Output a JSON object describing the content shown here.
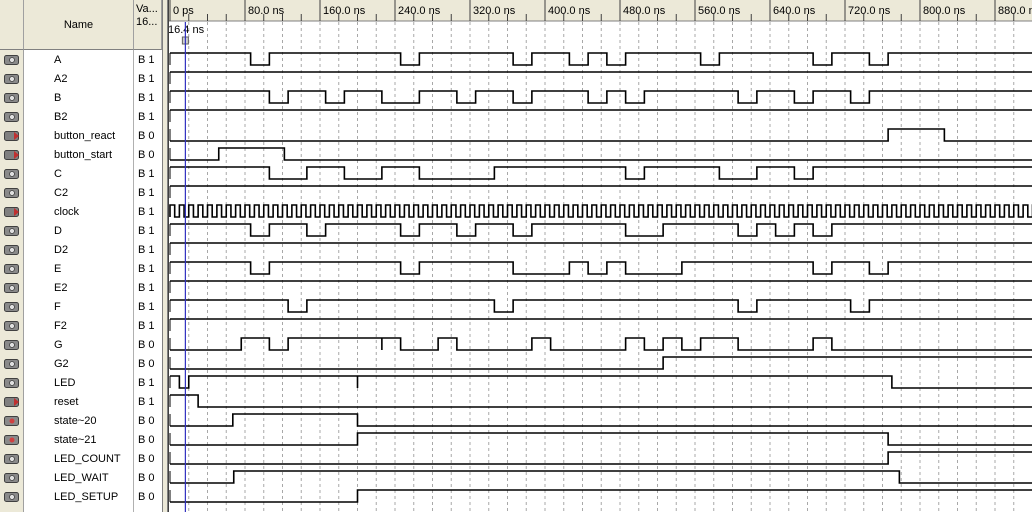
{
  "header": {
    "name_label": "Name",
    "value_label_1": "Va...",
    "value_label_2": "16..."
  },
  "time_bar": {
    "tick_labels": [
      "0 ps",
      "80.0 ns",
      "160.0 ns",
      "240.0 ns",
      "320.0 ns",
      "400.0 ns",
      "480.0 ns",
      "560.0 ns",
      "640.0 ns",
      "720.0 ns",
      "800.0 ns",
      "880.0 ns"
    ],
    "cursor_label": "16.4 ns"
  },
  "signals": [
    {
      "name": "A",
      "value": "B 1",
      "type": "output"
    },
    {
      "name": "A2",
      "value": "B 1",
      "type": "output"
    },
    {
      "name": "B",
      "value": "B 1",
      "type": "output"
    },
    {
      "name": "B2",
      "value": "B 1",
      "type": "output"
    },
    {
      "name": "button_react",
      "value": "B 0",
      "type": "input"
    },
    {
      "name": "button_start",
      "value": "B 0",
      "type": "input"
    },
    {
      "name": "C",
      "value": "B 1",
      "type": "output"
    },
    {
      "name": "C2",
      "value": "B 1",
      "type": "output"
    },
    {
      "name": "clock",
      "value": "B 1",
      "type": "input"
    },
    {
      "name": "D",
      "value": "B 1",
      "type": "output"
    },
    {
      "name": "D2",
      "value": "B 1",
      "type": "output"
    },
    {
      "name": "E",
      "value": "B 1",
      "type": "output"
    },
    {
      "name": "E2",
      "value": "B 1",
      "type": "output"
    },
    {
      "name": "F",
      "value": "B 1",
      "type": "output"
    },
    {
      "name": "F2",
      "value": "B 1",
      "type": "output"
    },
    {
      "name": "G",
      "value": "B 0",
      "type": "output"
    },
    {
      "name": "G2",
      "value": "B 0",
      "type": "output"
    },
    {
      "name": "LED",
      "value": "B 1",
      "type": "output"
    },
    {
      "name": "reset",
      "value": "B 1",
      "type": "input"
    },
    {
      "name": "state~20",
      "value": "B 0",
      "type": "buried"
    },
    {
      "name": "state~21",
      "value": "B 0",
      "type": "buried"
    },
    {
      "name": "LED_COUNT",
      "value": "B 0",
      "type": "output"
    },
    {
      "name": "LED_WAIT",
      "value": "B 0",
      "type": "output"
    },
    {
      "name": "LED_SETUP",
      "value": "B 0",
      "type": "output"
    }
  ],
  "colors": {
    "panel": "#ece9d8",
    "cursor": "#3030c0",
    "grid": "#9a9a9a",
    "wave": "#000000"
  }
}
